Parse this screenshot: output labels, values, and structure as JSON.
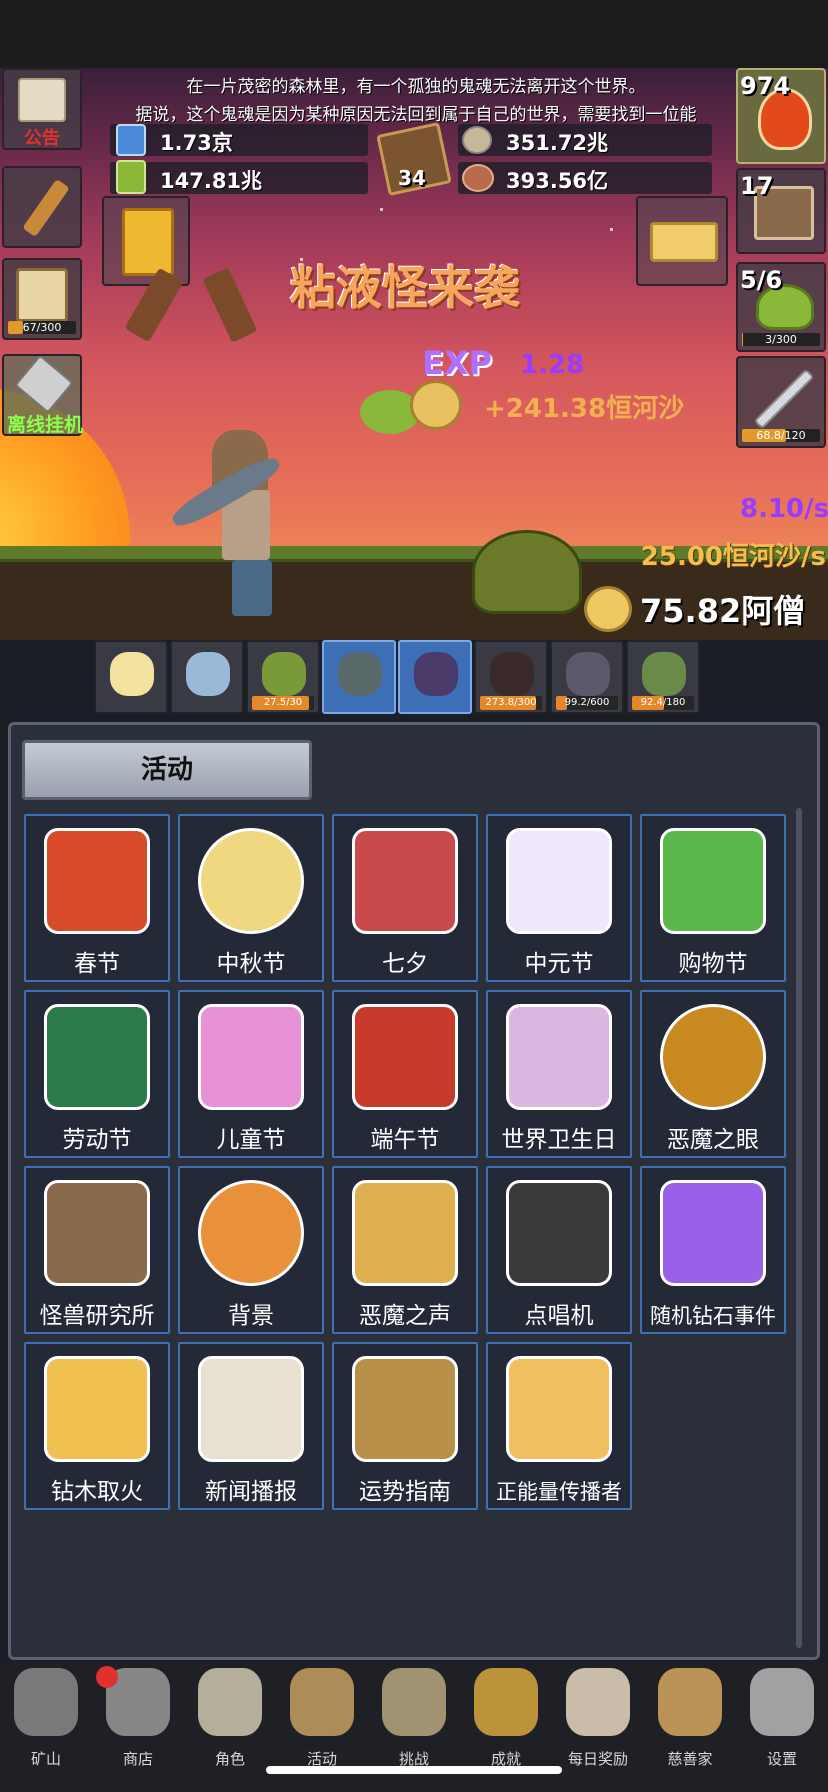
{
  "story": {
    "line1": "在一片茂密的森林里，有一个孤独的鬼魂无法离开这个世界。",
    "line2": "据说，这个鬼魂是因为某种原因无法回到属于自己的世界，需要找到一位能"
  },
  "resources": {
    "blue_potion": "1.73京",
    "green_potion": "147.81兆",
    "book_count": "34",
    "coin": "351.72兆",
    "meat": "393.56亿"
  },
  "left_buttons": {
    "notice_label": "公告",
    "torch_label": "",
    "beer_progress": "67/300",
    "beer_fraction": 0.22,
    "offline_label": "离线挂机"
  },
  "right_buttons": {
    "potion_count": "974",
    "chest_count": "17",
    "slime_count": "5/6",
    "slime_progress": "3/300",
    "slime_fraction": 0.01,
    "sword_progress": "68.8/120",
    "sword_fraction": 0.57
  },
  "battle": {
    "event_title": "粘液怪来袭",
    "exp_label": "EXP",
    "exp_gain": "1.28",
    "sand_gain": "+241.38恒河沙",
    "exp_rate": "8.10/s",
    "sand_rate": "25.00恒河沙/s",
    "gold_total": "75.82阿僧祇"
  },
  "monsters": [
    {
      "name": "candle",
      "progress": "",
      "fraction": 0
    },
    {
      "name": "egg",
      "progress": "",
      "fraction": 0
    },
    {
      "name": "slime",
      "progress": "27.5/30",
      "fraction": 0.92
    },
    {
      "name": "zombie",
      "progress": "",
      "fraction": 0
    },
    {
      "name": "bat",
      "progress": "",
      "fraction": 0
    },
    {
      "name": "spider",
      "progress": "273.8/300",
      "fraction": 0.91
    },
    {
      "name": "ghost",
      "progress": "99.2/600",
      "fraction": 0.17
    },
    {
      "name": "goblin",
      "progress": "92.4/180",
      "fraction": 0.51
    }
  ],
  "panel": {
    "title": "活动",
    "items": [
      {
        "label": "春节",
        "icon": "lantern-icon"
      },
      {
        "label": "中秋节",
        "icon": "moon-icon"
      },
      {
        "label": "七夕",
        "icon": "heart-icon"
      },
      {
        "label": "中元节",
        "icon": "ghost-icon"
      },
      {
        "label": "购物节",
        "icon": "money-icon"
      },
      {
        "label": "劳动节",
        "icon": "brush-icon"
      },
      {
        "label": "儿童节",
        "icon": "lollipop-icon"
      },
      {
        "label": "端午节",
        "icon": "mask-icon"
      },
      {
        "label": "世界卫生日",
        "icon": "ambulance-icon"
      },
      {
        "label": "恶魔之眼",
        "icon": "eye-icon"
      },
      {
        "label": "怪兽研究所",
        "icon": "lab-icon"
      },
      {
        "label": "背景",
        "icon": "sunset-icon"
      },
      {
        "label": "恶魔之声",
        "icon": "bell-icon"
      },
      {
        "label": "点唱机",
        "icon": "cassette-icon"
      },
      {
        "label": "随机钻石事件",
        "icon": "diamond-icon"
      },
      {
        "label": "钻木取火",
        "icon": "fire-stick-icon"
      },
      {
        "label": "新闻播报",
        "icon": "newspaper-icon"
      },
      {
        "label": "运势指南",
        "icon": "fortune-icon"
      },
      {
        "label": "正能量传播者",
        "icon": "crown-icon"
      }
    ]
  },
  "nav": [
    {
      "label": "矿山",
      "icon": "lantern-icon"
    },
    {
      "label": "商店",
      "icon": "stone-icon"
    },
    {
      "label": "角色",
      "icon": "skull-icon"
    },
    {
      "label": "活动",
      "icon": "scroll-icon"
    },
    {
      "label": "挑战",
      "icon": "map-icon"
    },
    {
      "label": "成就",
      "icon": "key-icon"
    },
    {
      "label": "每日奖励",
      "icon": "letter-icon"
    },
    {
      "label": "慈善家",
      "icon": "bread-icon"
    },
    {
      "label": "设置",
      "icon": "gear-icon"
    }
  ],
  "colors": {
    "accent_blue": "#3e6fb0",
    "exp_purple": "#9a3cff",
    "gold_text": "#f2c04a",
    "event_orange": "#f08a30"
  }
}
